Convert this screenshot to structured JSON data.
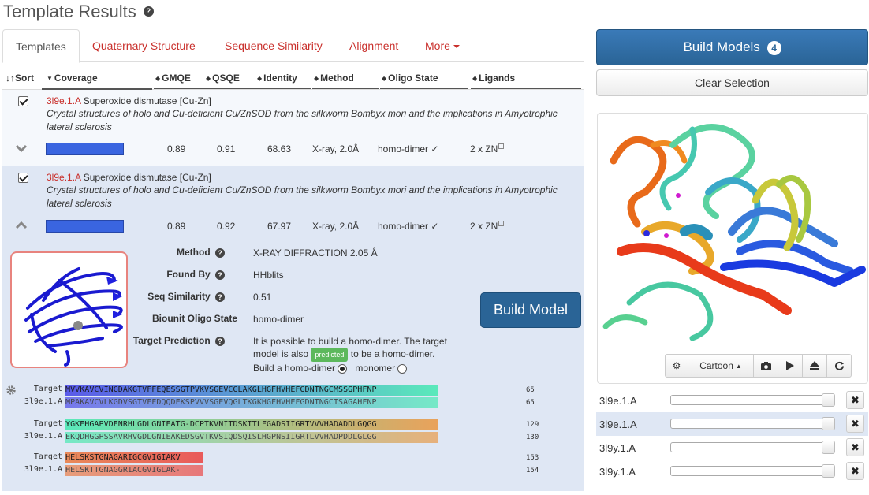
{
  "page": {
    "title": "Template Results",
    "help_glyph": "?"
  },
  "tabs": [
    {
      "label": "Templates",
      "active": true
    },
    {
      "label": "Quaternary Structure"
    },
    {
      "label": "Sequence Similarity"
    },
    {
      "label": "Alignment"
    },
    {
      "label": "More"
    }
  ],
  "sort_header": {
    "sort": "Sort",
    "columns": [
      "Coverage",
      "GMQE",
      "QSQE",
      "Identity",
      "Method",
      "Oligo State",
      "Ligands"
    ]
  },
  "templates": [
    {
      "id": "3l9e.1.A",
      "name": "Superoxide dismutase [Cu-Zn]",
      "description": "Crystal structures of holo and Cu-deficient Cu/ZnSOD from the silkworm Bombyx mori and the implications in Amyotrophic lateral sclerosis",
      "coverage": 1.0,
      "gmqe": "0.89",
      "qsqe": "0.91",
      "identity": "68.63",
      "method": "X-ray, 2.0Å",
      "oligo_state": "homo-dimer ✓",
      "ligands": "2 x ZN",
      "checked": true,
      "expanded": false
    },
    {
      "id": "3l9e.1.A",
      "name": "Superoxide dismutase [Cu-Zn]",
      "description": "Crystal structures of holo and Cu-deficient Cu/ZnSOD from the silkworm Bombyx mori and the implications in Amyotrophic lateral sclerosis",
      "coverage": 1.0,
      "gmqe": "0.89",
      "qsqe": "0.92",
      "identity": "67.97",
      "method": "X-ray, 2.0Å",
      "oligo_state": "homo-dimer ✓",
      "ligands": "2 x ZN",
      "checked": true,
      "expanded": true
    }
  ],
  "details": {
    "method_label": "Method",
    "method_value": "X-RAY DIFFRACTION 2.05 Å",
    "found_by_label": "Found By",
    "found_by_value": "HHblits",
    "seq_sim_label": "Seq Similarity",
    "seq_sim_value": "0.51",
    "biounit_label": "Biounit Oligo State",
    "biounit_value": "homo-dimer",
    "target_pred_label": "Target Prediction",
    "target_pred_text1": "It is possible to build a homo-dimer. The target",
    "target_pred_text2a": "model is also",
    "predicted_badge": "predicted",
    "target_pred_text2b": "to be a homo-dimer.",
    "build_homodimer": "Build a homo-dimer",
    "monomer": "monomer",
    "build_model_button": "Build Model"
  },
  "alignment": [
    {
      "target_label": "Target",
      "target_seq": "MVVKAVCVINGDAKGTVFFEQESSGTPVKVSGEVCGLAKGLHGFHVHEFGDNTNGCMSSGPHFNP",
      "template_label": "3l9e.1.A",
      "template_seq": "MPAKAVCVLKGDVSGTVFFDQQDEKSPVVVSGEVQGLTKGKHGFHVHEFGDNTNGCTSAGAHFNP",
      "target_end": "65",
      "template_end": "65",
      "hue_start": 240,
      "hue_end": 160
    },
    {
      "target_label": "Target",
      "target_seq": "YGKEHGAPVDENRHLGDLGNIEATG-DCPTKVNITDSKITLFGADSIIGRTVVVHADADDLGQGG",
      "template_label": "3l9e.1.A",
      "template_seq": "EKQDHGGPSSAVRHVGDLGNIEAKEDSGVTKVSIQDSQISLHGPNSIIGRTLVVHADPDDLGLGG",
      "target_end": "129",
      "template_end": "130",
      "hue_start": 160,
      "hue_end": 30
    },
    {
      "target_label": "Target",
      "target_seq": "HELSKSTGNAGARIGCGVIGIAKV",
      "template_label": "3l9e.1.A",
      "template_seq": "HELSKTTGNAGGRIACGVIGLAK-",
      "target_end": "153",
      "template_end": "154",
      "hue_start": 20,
      "hue_end": 0
    }
  ],
  "right_panel": {
    "build_models_label": "Build Models",
    "build_models_count": "4",
    "clear_selection_label": "Clear Selection",
    "viewer_mode": "Cartoon",
    "models": [
      {
        "label": "3l9e.1.A",
        "selected": false
      },
      {
        "label": "3l9e.1.A",
        "selected": true
      },
      {
        "label": "3l9y.1.A",
        "selected": false
      },
      {
        "label": "3l9y.1.A",
        "selected": false
      }
    ],
    "remove_glyph": "✖"
  }
}
